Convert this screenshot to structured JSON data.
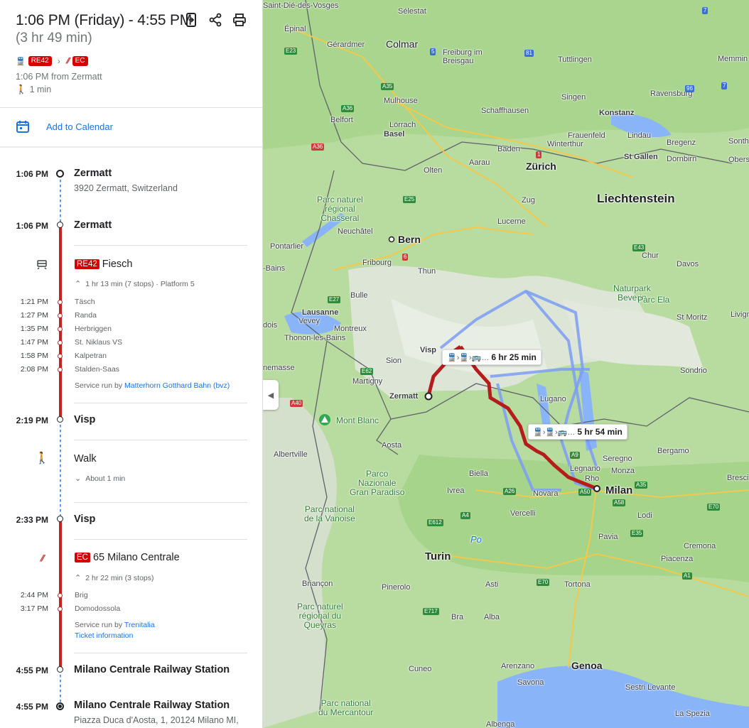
{
  "header": {
    "time_range": "1:06 PM (Friday) - 4:55 PM",
    "duration": "(3 hr 49 min)",
    "chips": [
      "RE42",
      "EC"
    ],
    "departure_info": "1:06 PM from Zermatt",
    "walk_info": "1 min",
    "icons": [
      "send-to-phone-icon",
      "share-icon",
      "print-icon"
    ]
  },
  "calendar": {
    "label": "Add to Calendar"
  },
  "timeline": {
    "start": {
      "time": "1:06 PM",
      "name": "Zermatt",
      "address": "3920 Zermatt, Switzerland"
    },
    "board1": {
      "time": "1:06 PM",
      "name": "Zermatt"
    },
    "leg1": {
      "chip": "RE42",
      "headsign": "Fiesch",
      "details": "1 hr 13 min (7 stops) · Platform 5",
      "stops": [
        {
          "time": "1:21 PM",
          "name": "Täsch"
        },
        {
          "time": "1:27 PM",
          "name": "Randa"
        },
        {
          "time": "1:35 PM",
          "name": "Herbriggen"
        },
        {
          "time": "1:47 PM",
          "name": "St. Niklaus VS"
        },
        {
          "time": "1:58 PM",
          "name": "Kalpetran"
        },
        {
          "time": "2:08 PM",
          "name": "Stalden-Saas"
        }
      ],
      "service_prefix": "Service run by",
      "service_link": "Matterhorn Gotthard Bahn (bvz)"
    },
    "alight1": {
      "time": "2:19 PM",
      "name": "Visp"
    },
    "walk": {
      "label": "Walk",
      "details": "About 1 min"
    },
    "board2": {
      "time": "2:33 PM",
      "name": "Visp"
    },
    "leg2": {
      "chip": "EC",
      "headsign": "65 Milano Centrale",
      "details": "2 hr 22 min (3 stops)",
      "stops": [
        {
          "time": "2:44 PM",
          "name": "Brig"
        },
        {
          "time": "3:17 PM",
          "name": "Domodossola"
        }
      ],
      "service_prefix": "Service run by",
      "service_link": "Trenitalia",
      "ticket_link": "Ticket information"
    },
    "alight2": {
      "time": "4:55 PM",
      "name": "Milano Centrale Railway Station"
    },
    "end": {
      "time": "4:55 PM",
      "name": "Milano Centrale Railway Station",
      "address": "Piazza Duca d'Aosta, 1, 20124 Milano MI,"
    }
  },
  "map": {
    "callouts": [
      {
        "text": "6 hr 25 min"
      },
      {
        "text": "5 hr 54 min"
      }
    ],
    "labels": {
      "selestat": "Sélestat",
      "saint_die": "Saint-Dié-des-Vosges",
      "epinal": "Épinal",
      "gerardmer": "Gérardmer",
      "colmar": "Colmar",
      "freiburg": "Freiburg im\nBreisgau",
      "tuttlingen": "Tuttlingen",
      "memmingen": "Memmin",
      "mulhouse": "Mulhouse",
      "singen": "Singen",
      "ravensburg": "Ravensburg",
      "schaffhausen": "Schaffhausen",
      "konstanz": "Konstanz",
      "belfort": "Belfort",
      "lorrach": "Lörrach",
      "basel": "Basel",
      "frauenfeld": "Frauenfeld",
      "lindau": "Lindau",
      "bregenz": "Bregenz",
      "winterthur": "Winterthur",
      "baden": "Baden",
      "zurich": "Zürich",
      "st_gallen": "St Gallen",
      "dornbirn": "Dornbirn",
      "olten": "Olten",
      "aarau": "Aarau",
      "sonth": "Sonth",
      "obers": "Obers",
      "liechtenstein": "Liechtenstein",
      "zug": "Zug",
      "chasseral": "Parc naturel\nrégional\nChasseral",
      "neuchatel": "Neuchâtel",
      "lucerne": "Lucerne",
      "bern": "Bern",
      "pontarlier": "Pontarlier",
      "chur": "Chur",
      "bains": "-Bains",
      "fribourg": "Fribourg",
      "thun": "Thun",
      "davos": "Davos",
      "beverin": "Naturpark\nBeverin",
      "parc_ela": "Parc Ela",
      "bulle": "Bulle",
      "st_moritz": "St Moritz",
      "livigno": "Livigno",
      "lausanne": "Lausanne",
      "vevey": "Vevey",
      "montreux": "Montreux",
      "dois": "dois",
      "thonon": "Thonon-les-Bains",
      "visp": "Visp",
      "sion": "Sion",
      "sondrio": "Sondrio",
      "annemasse": "nemasse",
      "martigny": "Martigny",
      "zermatt": "Zermatt",
      "lugano": "Lugano",
      "mont_blanc": "Mont Blanc",
      "albertville": "Albertville",
      "aosta": "Aosta",
      "bergamo": "Bergamo",
      "serengo": "Seregno",
      "legnano": "Legnano",
      "monza": "Monza",
      "rho": "Rho",
      "brescia": "Brescia",
      "gran_paradiso": "Parco\nNazionale\nGran Paradiso",
      "biella": "Biella",
      "ivrea": "Ivrea",
      "novara": "Novara",
      "milan": "Milan",
      "vanoise": "Parc national\nde la Vanoise",
      "vercelli": "Vercelli",
      "lodi": "Lodi",
      "po": "Po",
      "pavia": "Pavia",
      "turin": "Turin",
      "cremona": "Cremona",
      "piacenza": "Piacenza",
      "briancon": "Briançon",
      "asti": "Asti",
      "pinerolo": "Pinerolo",
      "tortona": "Tortona",
      "queyras": "Parc naturel\nrégional du\nQueyras",
      "bra": "Bra",
      "alba": "Alba",
      "cuneo": "Cuneo",
      "arenzano": "Arenzano",
      "genoa": "Genoa",
      "savona": "Savona",
      "sestri": "Sestri Levante",
      "mercantour": "Parc national\ndu Mercantour",
      "la_spezia": "La Spezia",
      "albenga": "Albenga"
    },
    "roads": [
      "E23",
      "A35",
      "5",
      "81",
      "7",
      "A36",
      "96",
      "7",
      "A36",
      "1",
      "E25",
      "6",
      "E43",
      "E27",
      "E62",
      "A40",
      "A9",
      "A26",
      "A50",
      "A35",
      "A4",
      "A58",
      "E70",
      "E612",
      "E35",
      "E70",
      "A1",
      "E717"
    ]
  },
  "colors": {
    "accent": "#1a73e8",
    "rail": "#c5221f",
    "alt_route": "#7b9cf4",
    "water": "#8ab4f8",
    "land": "#b4d89c"
  }
}
